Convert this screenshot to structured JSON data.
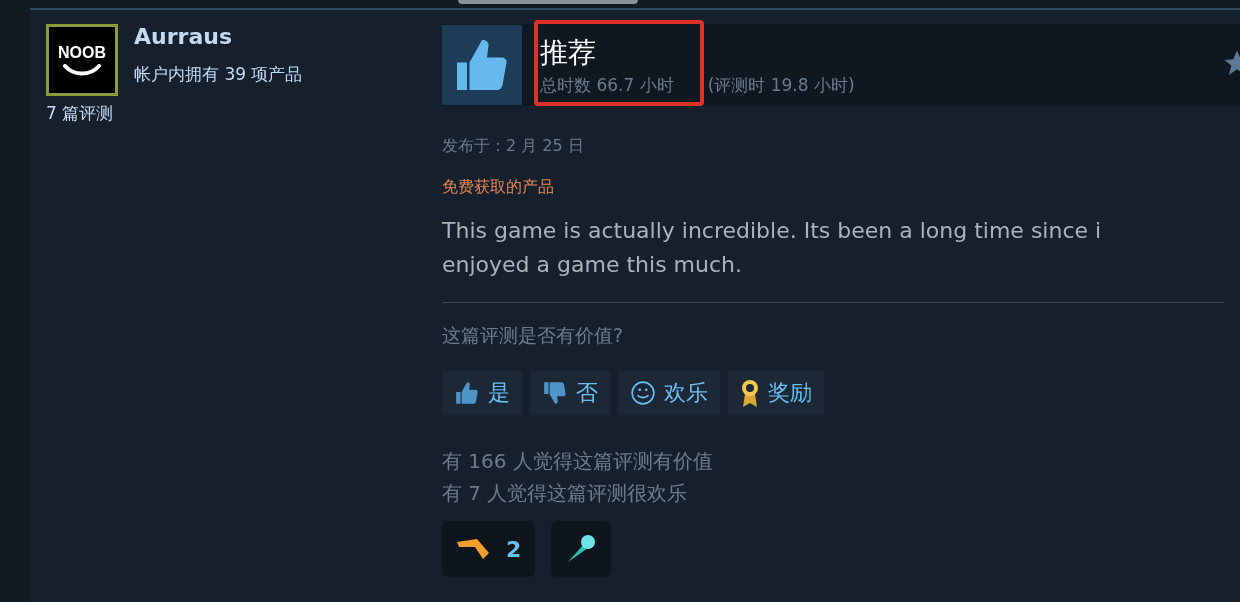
{
  "author": {
    "avatar_text": "NOOB",
    "name": "Aurraus",
    "products": "帐户内拥有 39 项产品",
    "reviews": "7 篇评测"
  },
  "review": {
    "verdict": "推荐",
    "recommended": true,
    "total_hours": "总时数 66.7 小时",
    "review_hours": "(评测时 19.8 小时)",
    "posted": "发布于：2 月 25 日",
    "source": "免费获取的产品",
    "body": "This game is actually incredible. Its been a long time since i enjoyed a game this much."
  },
  "helpful": {
    "question": "这篇评测是否有价值?",
    "buttons": [
      {
        "kind": "yes",
        "label": "是"
      },
      {
        "kind": "no",
        "label": "否"
      },
      {
        "kind": "funny",
        "label": "欢乐"
      },
      {
        "kind": "award",
        "label": "奖励"
      }
    ],
    "stats": [
      "有 166 人觉得这篇评测有价值",
      "有 7 人觉得这篇评测很欢乐"
    ]
  },
  "awards": [
    {
      "kind": "boomerang",
      "count": "2"
    },
    {
      "kind": "comet"
    }
  ]
}
